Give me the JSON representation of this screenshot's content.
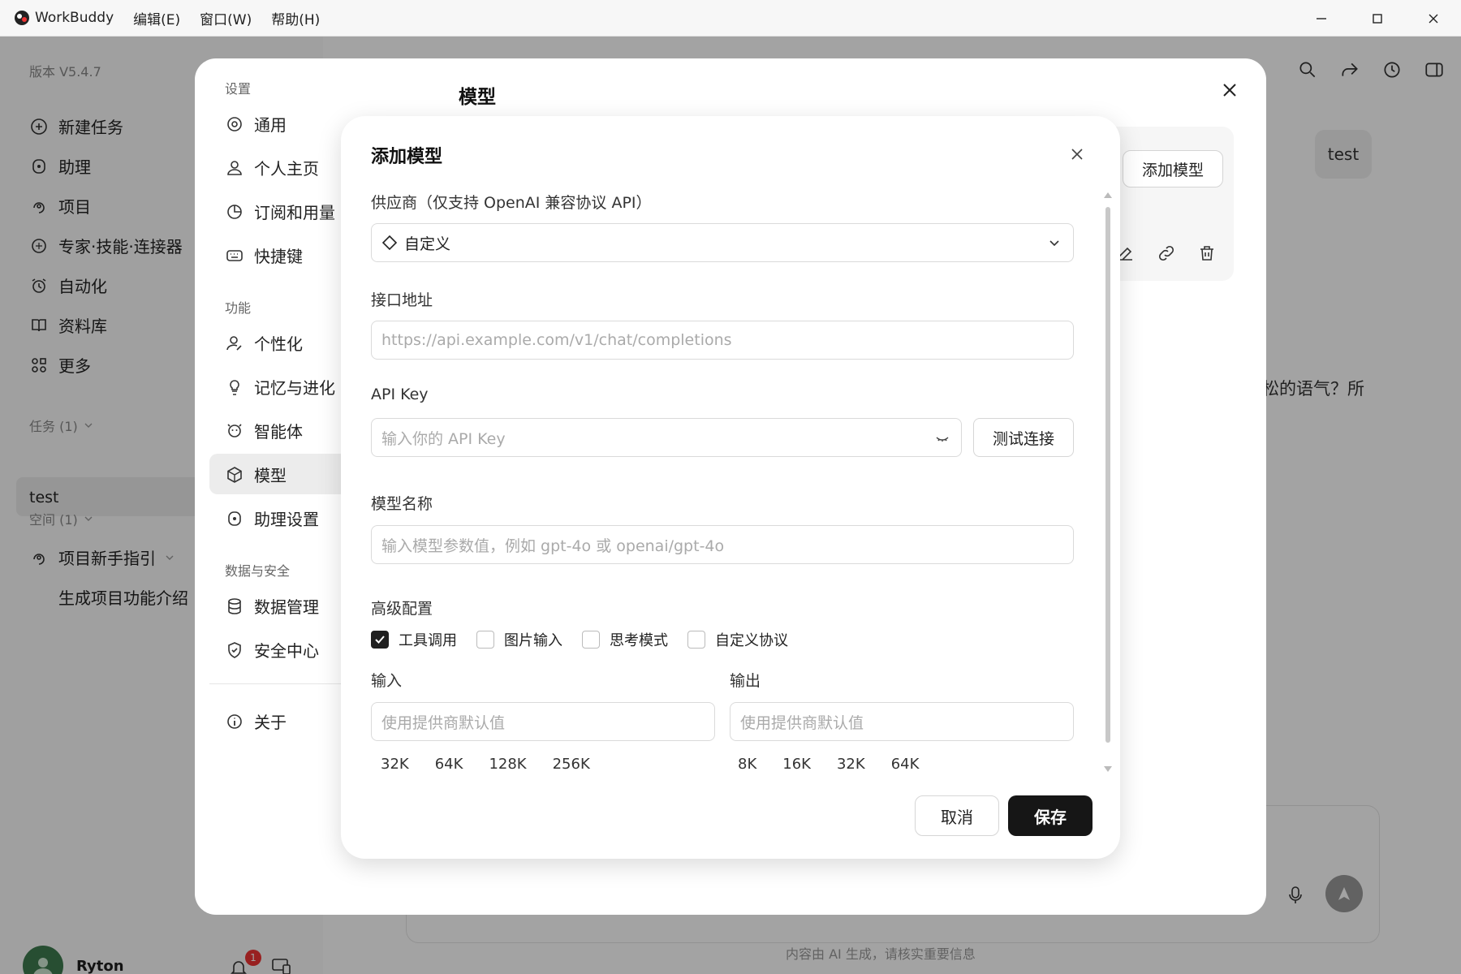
{
  "window": {
    "app_name": "WorkBuddy",
    "menu": [
      "编辑(E)",
      "窗口(W)",
      "帮助(H)"
    ]
  },
  "sidebar": {
    "version": "版本 V5.4.7",
    "items": [
      {
        "label": "新建任务",
        "icon": "plus-circle-icon"
      },
      {
        "label": "助理",
        "icon": "assistant-icon"
      },
      {
        "label": "项目",
        "icon": "project-icon"
      },
      {
        "label": "专家·技能·连接器",
        "icon": "expert-icon"
      },
      {
        "label": "自动化",
        "icon": "alarm-icon"
      },
      {
        "label": "资料库",
        "icon": "book-icon"
      },
      {
        "label": "更多",
        "icon": "apps-icon"
      }
    ],
    "tasks_section": "任务 (1)",
    "task_item": "test",
    "space_section": "空间 (1)",
    "space_item": "项目新手指引",
    "space_sub_item": "生成项目功能介绍",
    "user_name": "Ryton",
    "notification_count": "1"
  },
  "chat": {
    "user_message": "test",
    "reply_fragment": "松的语气？所",
    "disclaimer": "内容由 AI 生成，请核实重要信息"
  },
  "settings": {
    "title": "模型",
    "groups": [
      {
        "label": "设置",
        "items": [
          {
            "label": "通用",
            "icon": "settings-icon"
          },
          {
            "label": "个人主页",
            "icon": "user-icon"
          },
          {
            "label": "订阅和用量",
            "icon": "pie-icon"
          },
          {
            "label": "快捷键",
            "icon": "keyboard-icon"
          }
        ]
      },
      {
        "label": "功能",
        "items": [
          {
            "label": "个性化",
            "icon": "user-edit-icon"
          },
          {
            "label": "记忆与进化",
            "icon": "bulb-icon"
          },
          {
            "label": "智能体",
            "icon": "agent-icon"
          },
          {
            "label": "模型",
            "icon": "model-icon"
          },
          {
            "label": "助理设置",
            "icon": "assistant-icon"
          }
        ]
      },
      {
        "label": "数据与安全",
        "items": [
          {
            "label": "数据管理",
            "icon": "database-icon"
          },
          {
            "label": "安全中心",
            "icon": "shield-icon"
          }
        ]
      }
    ],
    "about": "关于",
    "add_model_button": "添加模型"
  },
  "dialog": {
    "title": "添加模型",
    "provider_label": "供应商（仅支持 OpenAI 兼容协议 API）",
    "provider_value": "自定义",
    "endpoint_label": "接口地址",
    "endpoint_placeholder": "https://api.example.com/v1/chat/completions",
    "apikey_label": "API Key",
    "apikey_placeholder": "输入你的 API Key",
    "test_button": "测试连接",
    "model_name_label": "模型名称",
    "model_name_placeholder": "输入模型参数值，例如 gpt-4o 或 openai/gpt-4o",
    "advanced_label": "高级配置",
    "checkboxes": [
      {
        "label": "工具调用",
        "checked": true
      },
      {
        "label": "图片输入",
        "checked": false
      },
      {
        "label": "思考模式",
        "checked": false
      },
      {
        "label": "自定义协议",
        "checked": false
      }
    ],
    "input_label": "输入",
    "input_placeholder": "使用提供商默认值",
    "input_chips": [
      "32K",
      "64K",
      "128K",
      "256K"
    ],
    "output_label": "输出",
    "output_placeholder": "使用提供商默认值",
    "output_chips": [
      "8K",
      "16K",
      "32K",
      "64K"
    ],
    "cancel_button": "取消",
    "save_button": "保存"
  }
}
